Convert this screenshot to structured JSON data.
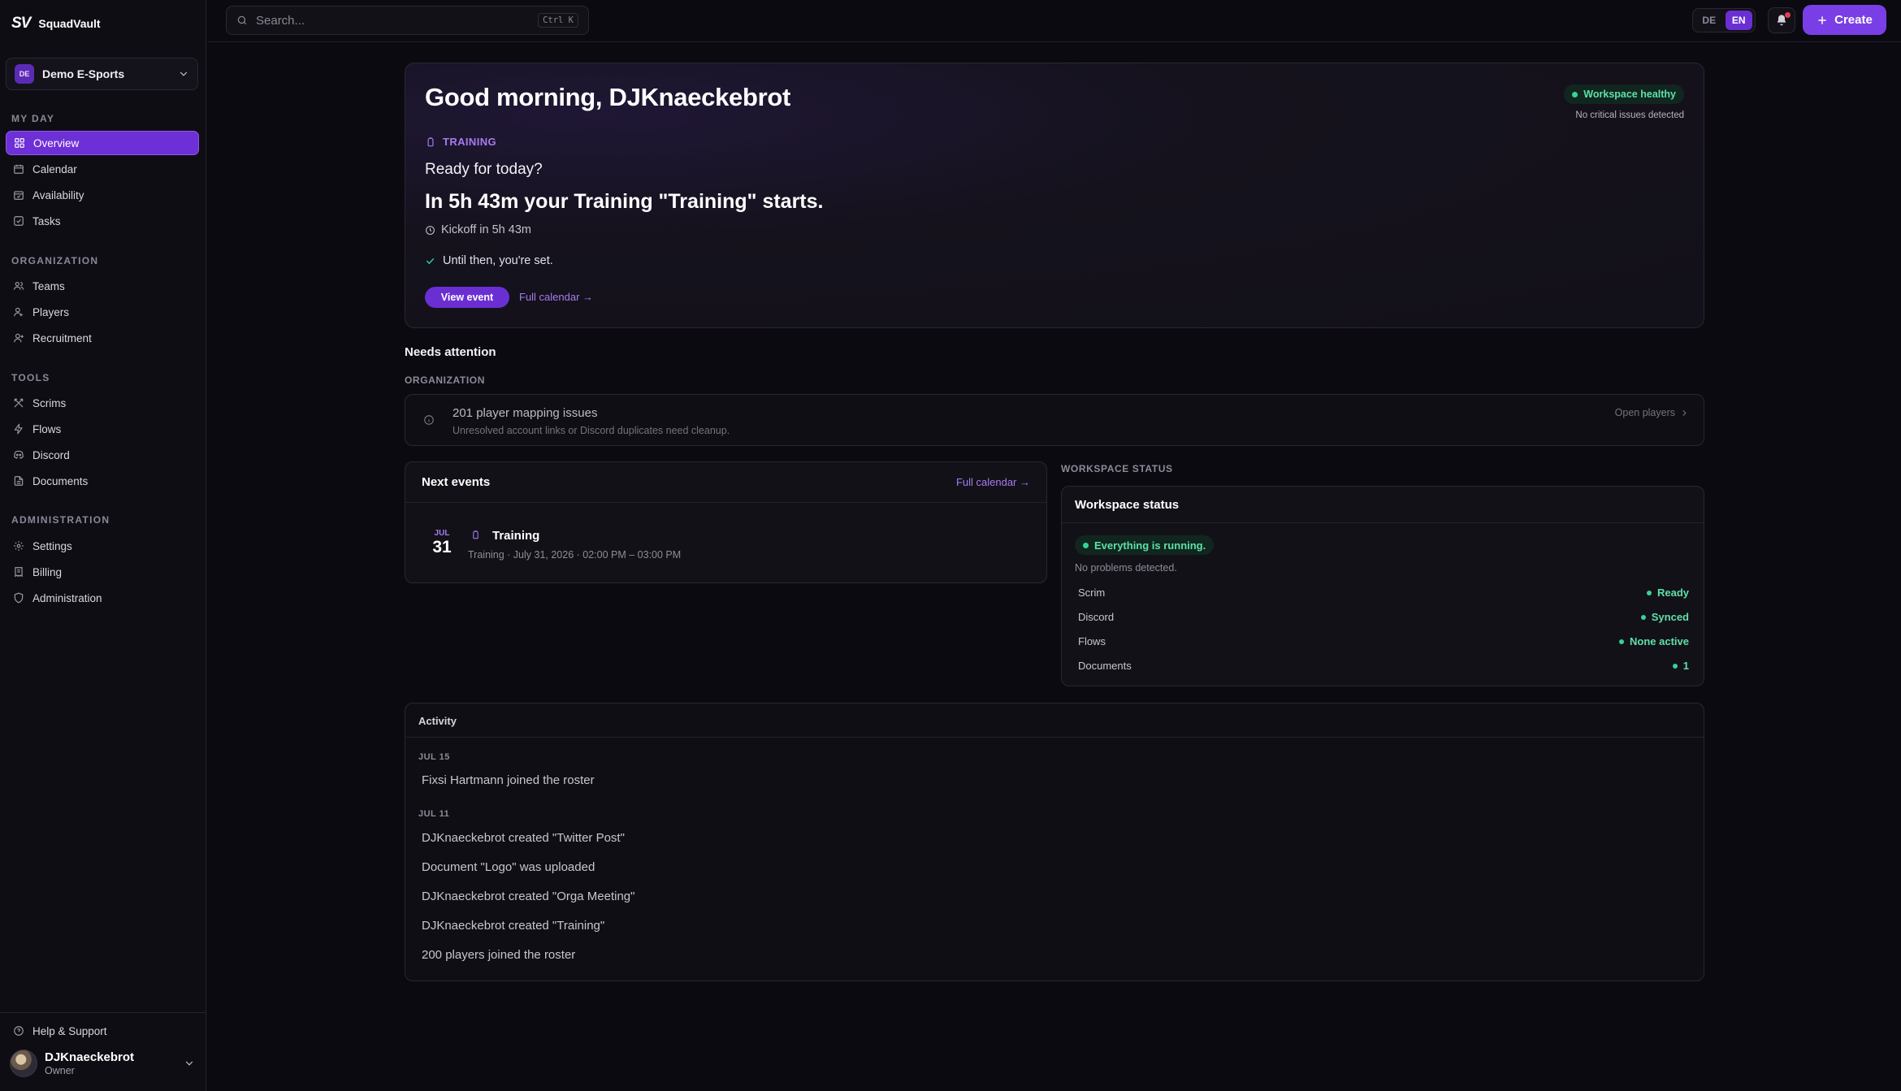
{
  "brand": {
    "logo": "SV",
    "name": "SquadVault"
  },
  "org": {
    "badge": "DE",
    "name": "Demo E-Sports"
  },
  "nav": {
    "my_day": {
      "label": "MY DAY",
      "items": [
        "Overview",
        "Calendar",
        "Availability",
        "Tasks"
      ]
    },
    "organization": {
      "label": "ORGANIZATION",
      "items": [
        "Teams",
        "Players",
        "Recruitment"
      ]
    },
    "tools": {
      "label": "TOOLS",
      "items": [
        "Scrims",
        "Flows",
        "Discord",
        "Documents"
      ]
    },
    "administration": {
      "label": "ADMINISTRATION",
      "items": [
        "Settings",
        "Billing",
        "Administration"
      ]
    },
    "active": "Overview"
  },
  "help": {
    "label": "Help & Support"
  },
  "user": {
    "name": "DJKnaeckebrot",
    "role": "Owner"
  },
  "search": {
    "placeholder": "Search...",
    "shortcut": "Ctrl K"
  },
  "lang": {
    "de": "DE",
    "en": "EN",
    "selected": "EN"
  },
  "create": {
    "label": "Create"
  },
  "hero": {
    "greeting": "Good morning, DJKnaeckebrot",
    "health_label": "Workspace healthy",
    "health_sub": "No critical issues detected",
    "event_type": "TRAINING",
    "question": "Ready for today?",
    "headline": "In 5h 43m your Training \"Training\" starts.",
    "kickoff": "Kickoff in 5h 43m",
    "status": "Until then, you're set.",
    "view_button": "View event",
    "calendar_link": "Full calendar →"
  },
  "attention": {
    "title": "Needs attention",
    "category": "ORGANIZATION",
    "issue_title": "201 player mapping issues",
    "issue_sub": "Unresolved account links or Discord duplicates need cleanup.",
    "action": "Open players"
  },
  "next_events": {
    "title": "Next events",
    "link": "Full calendar →",
    "items": [
      {
        "month": "JUL",
        "day": "31",
        "title": "Training",
        "details": "Training · July 31, 2026 · 02:00 PM – 03:00 PM"
      }
    ]
  },
  "workspace_status": {
    "kicker": "WORKSPACE STATUS",
    "title": "Workspace status",
    "pill": "Everything is running.",
    "sub": "No problems detected.",
    "rows": [
      {
        "label": "Scrim",
        "value": "Ready"
      },
      {
        "label": "Discord",
        "value": "Synced"
      },
      {
        "label": "Flows",
        "value": "None active"
      },
      {
        "label": "Documents",
        "value": "1"
      }
    ]
  },
  "activity": {
    "title": "Activity",
    "groups": [
      {
        "date": "JUL 15",
        "items": [
          "Fixsi Hartmann joined the roster"
        ]
      },
      {
        "date": "JUL 11",
        "items": [
          "DJKnaeckebrot created \"Twitter Post\"",
          "Document \"Logo\" was uploaded",
          "DJKnaeckebrot created \"Orga Meeting\"",
          "DJKnaeckebrot created \"Training\"",
          "200 players joined the roster"
        ]
      }
    ]
  },
  "colors": {
    "accent": "#6d2fd6",
    "success": "#34d399",
    "background": "#0c0a11"
  }
}
